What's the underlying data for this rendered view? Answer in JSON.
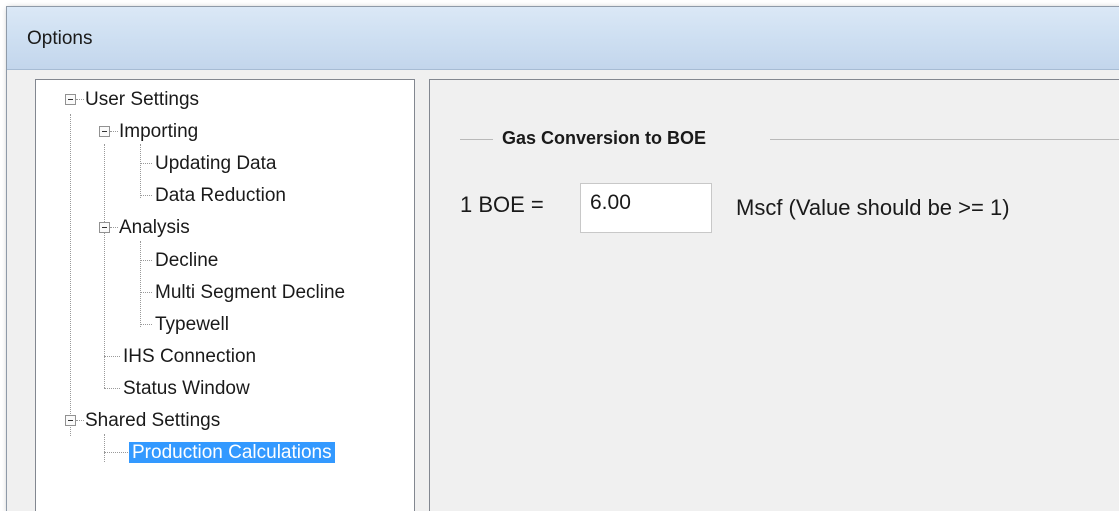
{
  "window": {
    "title": "Options"
  },
  "tree": {
    "user_settings": "User Settings",
    "importing": "Importing",
    "updating_data": "Updating Data",
    "data_reduction": "Data Reduction",
    "analysis": "Analysis",
    "decline": "Decline",
    "multi_segment_decline": "Multi Segment Decline",
    "typewell": "Typewell",
    "ihs_connection": "IHS Connection",
    "status_window": "Status Window",
    "shared_settings": "Shared Settings",
    "production_calculations": "Production Calculations",
    "selected_item": "Production Calculations"
  },
  "gas_conversion": {
    "group_title": "Gas Conversion to BOE",
    "boe_label": "1 BOE =",
    "value": "6.00",
    "unit_label": "Mscf (Value should be >= 1)"
  },
  "colors": {
    "selection_bg": "#3399ff",
    "selection_text": "#ffffff",
    "title_bar": "#cfe0f2"
  }
}
